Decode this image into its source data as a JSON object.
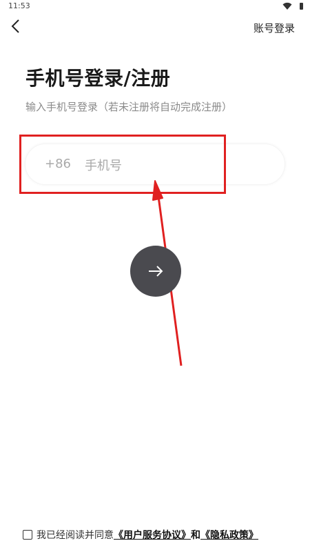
{
  "status_bar": {
    "time": "11:53"
  },
  "header": {
    "back_icon": "chevron-left-icon",
    "account_login_label": "账号登录"
  },
  "main": {
    "title": "手机号登录/注册",
    "subtitle": "输入手机号登录（若未注册将自动完成注册）",
    "phone": {
      "country_code": "+86",
      "placeholder": "手机号",
      "value": ""
    },
    "next_icon": "arrow-right-icon"
  },
  "agreement": {
    "prefix": "我已经阅读并同意",
    "terms_link": "《用户服务协议》",
    "and": "和",
    "privacy_link": "《隐私政策》",
    "checked": false
  },
  "colors": {
    "annotation": "#e02020",
    "next_button": "#4a4a4f",
    "subtitle": "#8a8a8a",
    "placeholder": "#a9a9a9"
  }
}
